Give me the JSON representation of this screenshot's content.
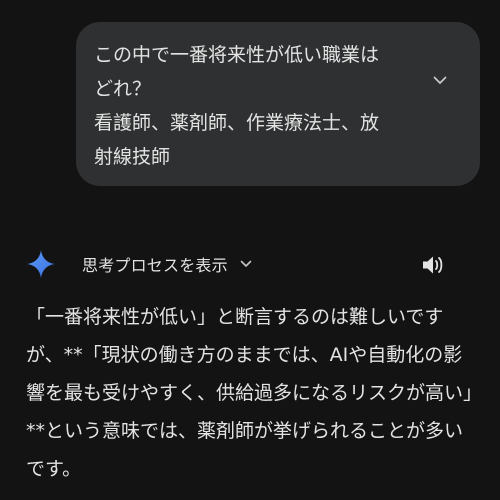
{
  "user_message": {
    "text": "この中で一番将来性が低い職業は\nどれ？\n看護師、薬剤師、作業療法士、放\n射線技師"
  },
  "icons": {
    "expand": "chevron-down-icon",
    "assistant": "gemini-sparkle-icon",
    "speaker": "speaker-icon"
  },
  "thinking": {
    "label": "思考プロセスを表示"
  },
  "response": {
    "text": "「一番将来性が低い」と断言するのは難しいですが、**「現状の働き方のままでは、AIや自動化の影響を最も受けやすく、供給過多になるリスクが高い」**という意味では、薬剤師が挙げられることが多いです。"
  },
  "colors": {
    "background": "#131314",
    "bubble": "#2f3031",
    "text": "#e3e3e3",
    "sparkle_start": "#4f8cf7",
    "sparkle_end": "#3b6fe0"
  }
}
